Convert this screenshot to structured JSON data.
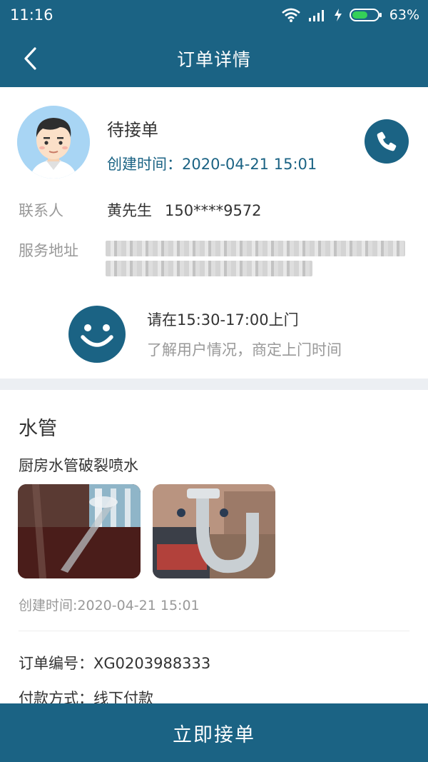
{
  "status_bar": {
    "time": "11:16",
    "battery_percent": "63%",
    "battery_level": 0.63,
    "icons": [
      "wifi-icon",
      "signal-icon",
      "charging-icon",
      "battery-icon"
    ]
  },
  "header": {
    "title": "订单详情",
    "back_icon": "chevron-left-icon"
  },
  "order": {
    "status": "待接单",
    "created_time": "创建时间：2020-04-21 15:01",
    "contact_label": "联系人",
    "contact_name": "黄先生",
    "contact_phone": "150****9572",
    "address_label": "服务地址",
    "visit_window": "请在15:30-17:00上门",
    "visit_hint": "了解用户情况，商定上门时间"
  },
  "detail": {
    "category": "水管",
    "description": "厨房水管破裂喷水",
    "post_time": "创建时间:2020-04-21 15:01",
    "order_number": "订单编号：XG0203988333",
    "payment_method": "付款方式：线下付款"
  },
  "footer": {
    "accept_label": "立即接单"
  },
  "colors": {
    "brand": "#1b6384",
    "muted_text": "#999999",
    "divider_band": "#eceff3"
  }
}
